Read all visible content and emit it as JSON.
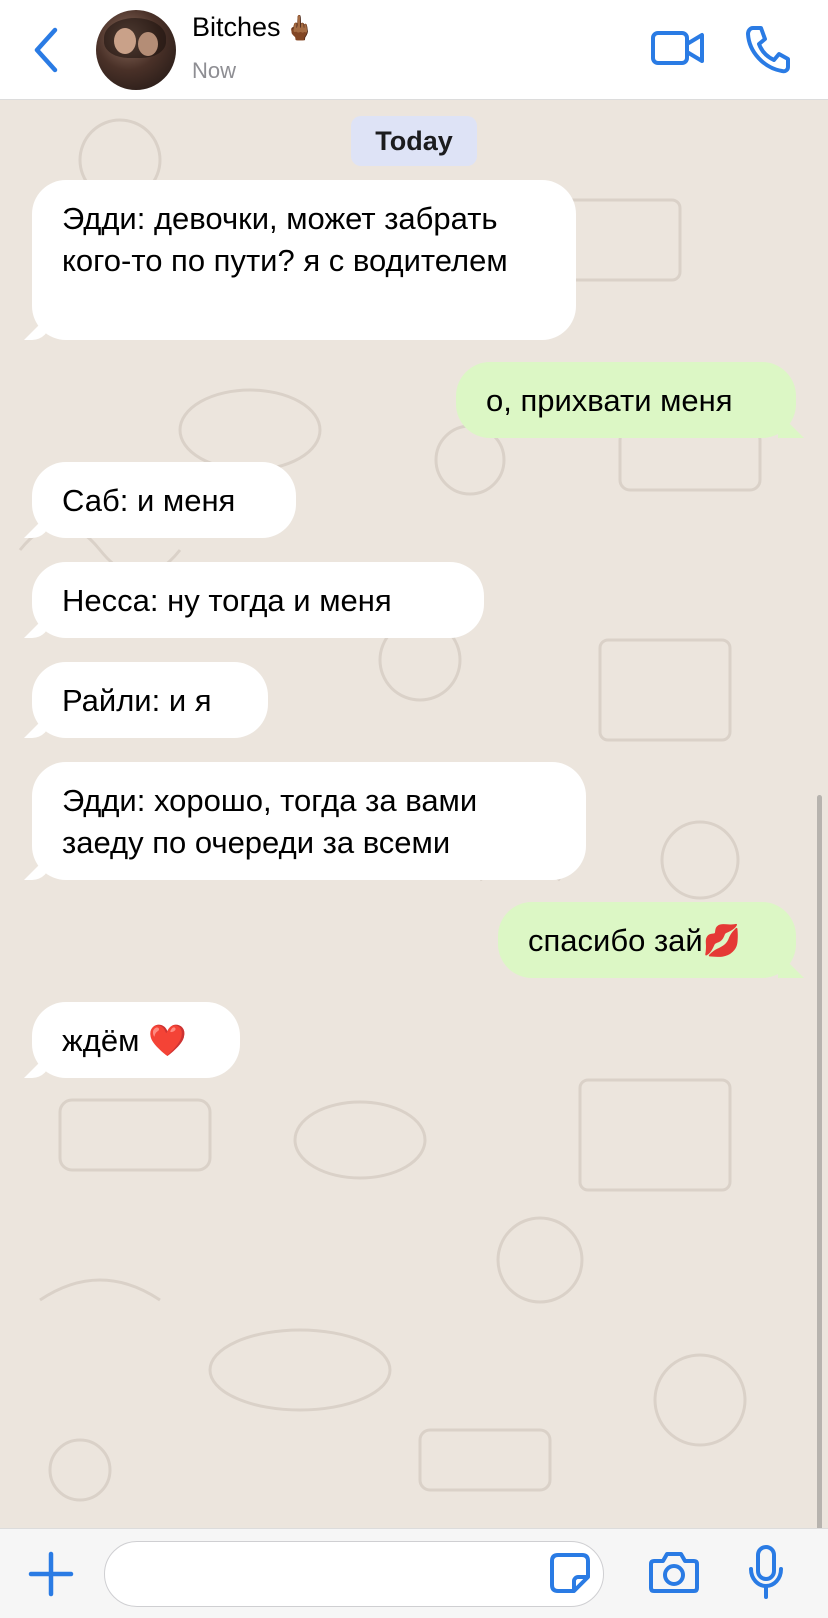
{
  "header": {
    "title": "Bitches",
    "title_emoji": "🖕🏾",
    "status": "Now",
    "icons": [
      "back-chevron-icon",
      "video-camera-icon",
      "phone-icon"
    ]
  },
  "chat": {
    "date_label": "Today",
    "messages": [
      {
        "direction": "in",
        "text": "Эдди: девочки, может забрать кого-то по пути? я с водителем"
      },
      {
        "direction": "out",
        "text": "о, прихвати меня"
      },
      {
        "direction": "in",
        "text": "Саб: и меня"
      },
      {
        "direction": "in",
        "text": "Несса: ну тогда и меня"
      },
      {
        "direction": "in",
        "text": "Райли: и я"
      },
      {
        "direction": "in",
        "text": "Эдди: хорошо, тогда за вами заеду по очереди за всеми"
      },
      {
        "direction": "out",
        "text": "спасибо зай💋"
      },
      {
        "direction": "in",
        "text": "ждём ❤️"
      }
    ]
  },
  "input_bar": {
    "value": "",
    "icons": [
      "plus-icon",
      "sticker-icon",
      "camera-icon",
      "microphone-icon"
    ]
  },
  "colors": {
    "accent": "#2a7be4",
    "incoming_bubble": "#ffffff",
    "outgoing_bubble": "#dcf7c5",
    "chat_background": "#ece5dd",
    "date_chip": "#dee3f6"
  }
}
